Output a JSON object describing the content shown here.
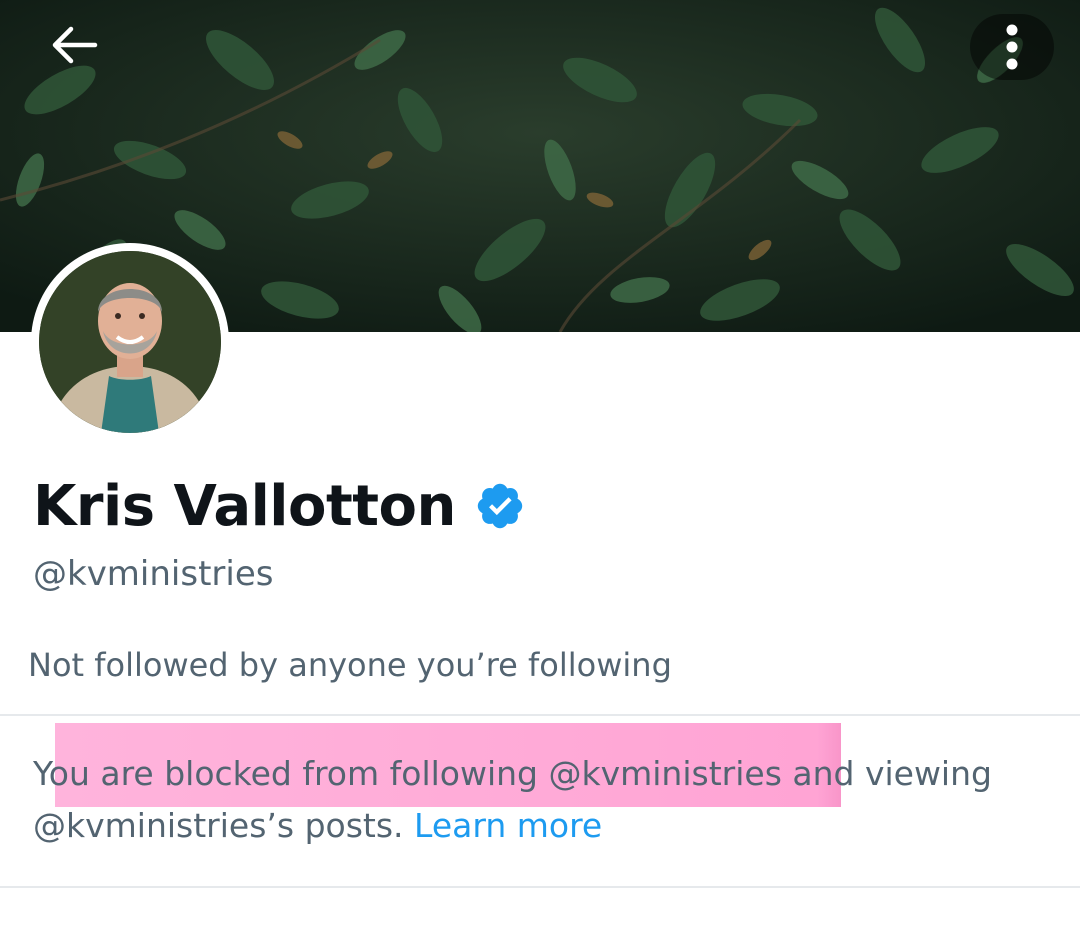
{
  "header": {
    "back_icon": "arrow-left-icon",
    "more_icon": "more-vertical-icon",
    "banner_image": "dark green foliage banner"
  },
  "profile": {
    "avatar": "profile photo of smiling man",
    "display_name": "Kris Vallotton",
    "verified_icon": "verified-badge-icon",
    "verified_color": "#1d9bf0",
    "handle": "@kvministries",
    "followers_note": "Not followed by anyone you’re following"
  },
  "blocked_notice": {
    "message": "You are blocked from following @kvministries and viewing @kvministries’s posts.",
    "link_label": "Learn more",
    "link_color": "#1d9bf0",
    "highlight_color": "#ffa8d6"
  }
}
